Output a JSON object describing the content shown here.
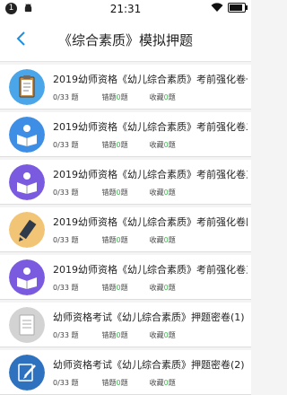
{
  "status": {
    "notification_count": "1",
    "time": "21:31",
    "battery_level_percent": 90
  },
  "nav": {
    "title": "《综合素质》模拟押题"
  },
  "labels": {
    "suffix_ti": "题",
    "wrong": "错题",
    "fav": "收藏"
  },
  "items": [
    {
      "title": "2019幼师资格《幼儿综合素质》考前强化卷一",
      "progress": "0/33",
      "wrong": "0",
      "fav": "0",
      "icon": "clipboard-icon",
      "color": "#4aa6e8"
    },
    {
      "title": "2019幼师资格《幼儿综合素质》考前强化卷二",
      "progress": "0/33",
      "wrong": "0",
      "fav": "0",
      "icon": "reader-icon",
      "color": "#3e8ee6"
    },
    {
      "title": "2019幼师资格《幼儿综合素质》考前强化卷三",
      "progress": "0/33",
      "wrong": "0",
      "fav": "0",
      "icon": "reader-icon",
      "color": "#7a5be0"
    },
    {
      "title": "2019幼师资格《幼儿综合素质》考前强化卷四",
      "progress": "0/33",
      "wrong": "0",
      "fav": "0",
      "icon": "pencil-icon",
      "color": "#f1c476"
    },
    {
      "title": "2019幼师资格《幼儿综合素质》考前强化卷五",
      "progress": "0/33",
      "wrong": "0",
      "fav": "0",
      "icon": "reader-icon",
      "color": "#7a5be0"
    },
    {
      "title": "幼师资格考试《幼儿综合素质》押题密卷(1)",
      "progress": "0/33",
      "wrong": "0",
      "fav": "0",
      "icon": "document-icon",
      "color": "#d3d3d3"
    },
    {
      "title": "幼师资格考试《幼儿综合素质》押题密卷(2)",
      "progress": "0/33",
      "wrong": "0",
      "fav": "0",
      "icon": "edit-icon",
      "color": "#2e72bf"
    }
  ]
}
